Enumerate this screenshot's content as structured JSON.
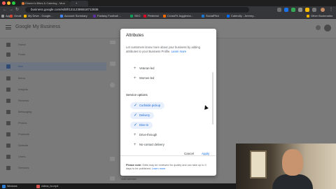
{
  "browser": {
    "tabs": [
      {
        "label": "Dineen's Bites & Catering - Mon"
      },
      {
        "label": ""
      }
    ],
    "url": "business.google.com/edit/l/12112386518712836",
    "bookmarks": [
      {
        "label": "Gmail",
        "color": "#d44638"
      },
      {
        "label": "My Drive - Google...",
        "color": "#f4b400"
      },
      {
        "label": "Account Summary",
        "color": "#4285f4"
      },
      {
        "label": "Fantasy Football ...",
        "color": "#5f2ea5"
      },
      {
        "label": "SEO",
        "color": "#0f9d58"
      },
      {
        "label": "Pinterest",
        "color": "#e60023"
      },
      {
        "label": "CrossFit Jugglerna...",
        "color": "#ff6d00"
      },
      {
        "label": "SocialPilot",
        "color": "#1976d2"
      },
      {
        "label": "Calendly - Jeremy...",
        "color": "#006bff"
      },
      {
        "label": "Other Bookmarks",
        "color": "#f4b400"
      }
    ]
  },
  "app": {
    "brand": "Google My Business",
    "sidebar_items": [
      {
        "label": "Home",
        "icon": "home-icon",
        "active": false
      },
      {
        "label": "Posts",
        "icon": "posts-icon",
        "active": false
      },
      {
        "label": "Info",
        "icon": "store-icon",
        "active": true
      },
      {
        "label": "Menu",
        "icon": "menu-icon",
        "active": false
      },
      {
        "label": "Insights",
        "icon": "insights-icon",
        "active": false
      },
      {
        "label": "Reviews",
        "icon": "reviews-icon",
        "active": false
      },
      {
        "label": "Messaging",
        "icon": "messaging-icon",
        "active": false
      },
      {
        "label": "Photos",
        "icon": "photos-icon",
        "active": false
      },
      {
        "label": "Products",
        "icon": "products-icon",
        "active": false
      },
      {
        "label": "Website",
        "icon": "website-icon",
        "active": false
      },
      {
        "label": "Users",
        "icon": "users-icon",
        "active": false
      },
      {
        "label": "Services",
        "icon": "services-icon",
        "active": false
      }
    ],
    "address_label": "Add website"
  },
  "dialog": {
    "title": "Attributes",
    "description": "Let customers know more about your business by adding attributes to your Business Profile.",
    "learn_more": "Learn more",
    "top_attributes": [
      {
        "label": "Veteran-led",
        "selected": false
      },
      {
        "label": "Women-led",
        "selected": false
      }
    ],
    "section_title": "Service options",
    "service_options": [
      {
        "label": "Curbside pickup",
        "selected": true
      },
      {
        "label": "Delivery",
        "selected": true
      },
      {
        "label": "Dine-in",
        "selected": true
      },
      {
        "label": "Drive-through",
        "selected": false
      },
      {
        "label": "No-contact delivery",
        "selected": false
      }
    ],
    "cancel_label": "Cancel",
    "apply_label": "Apply",
    "footer_bold": "Please note:",
    "footer_text": "Edits may be reviewed for quality and can take up to 3 days to be published.",
    "footer_link": "Learn more",
    "accent_color": "#1a73e8"
  },
  "taskbar": [
    {
      "label": "Windows"
    },
    {
      "label": "videos_ho.mp4"
    }
  ]
}
